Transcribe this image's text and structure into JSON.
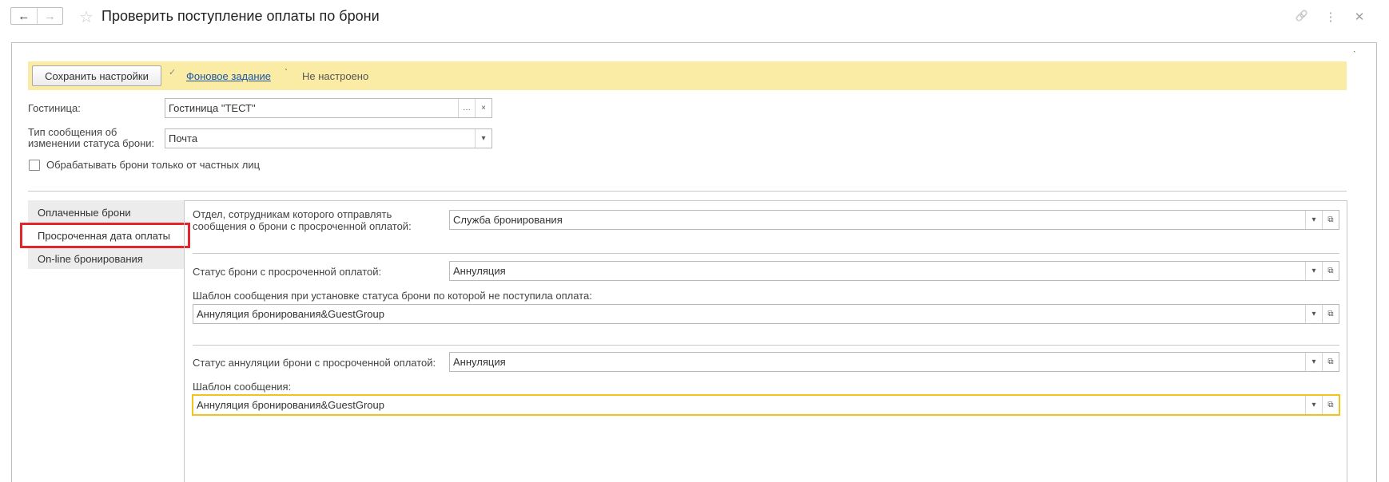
{
  "window": {
    "title": "Проверить поступление оплаты по брони",
    "back_icon": "←",
    "forward_icon": "→",
    "star_icon": "☆",
    "link_icon": "🔗",
    "more_icon": "⋮",
    "close_icon": "✕"
  },
  "cmdbar": {
    "save_label": "Сохранить настройки",
    "background_task_link": "Фоновое задание",
    "status_text": "Не настроено"
  },
  "header_form": {
    "hotel_label": "Гостиница:",
    "hotel_value": "Гостиница \"ТЕСТ\"",
    "message_type_label_line1": "Тип сообщения об",
    "message_type_label_line2": "изменении статуса брони:",
    "message_type_value": "Почта",
    "private_only_label": "Обрабатывать брони только от частных лиц",
    "private_only_checked": false
  },
  "tabs": [
    {
      "label": "Оплаченные брони",
      "active": false
    },
    {
      "label": "Просроченная дата оплаты",
      "active": true
    },
    {
      "label": "On-line бронирования",
      "active": false
    }
  ],
  "overdue": {
    "department_label_line1": "Отдел, сотрудникам которого отправлять",
    "department_label_line2": "сообщения о брони с просроченной оплатой:",
    "department_value": "Служба бронирования",
    "status_label": "Статус брони с просроченной оплатой:",
    "status_value": "Аннуляция",
    "template_label": "Шаблон сообщения при установке статуса брони по которой не поступила оплата:",
    "template_value": "Аннуляция бронирования&GuestGroup",
    "cancel_status_label": "Статус аннуляции брони с просроченной оплатой:",
    "cancel_status_value": "Аннуляция",
    "cancel_template_label": "Шаблон сообщения:",
    "cancel_template_value": "Аннуляция бронирования&GuestGroup"
  },
  "colors": {
    "command_bar": "#fbeca5",
    "link": "#1a55a8",
    "highlight_frame": "#e2262b",
    "active_field_border": "#f2c318"
  }
}
